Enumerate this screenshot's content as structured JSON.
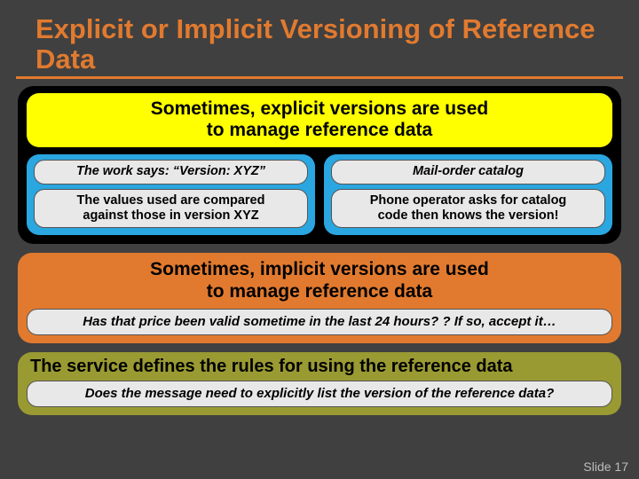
{
  "title": "Explicit or Implicit Versioning of Reference Data",
  "yellow": {
    "line1": "Sometimes, explicit versions are used",
    "line2": "to manage reference data"
  },
  "left": {
    "top": "The work says: “Version: XYZ”",
    "bottom_l1": "The values used are compared",
    "bottom_l2": "against those in version XYZ"
  },
  "right": {
    "top": "Mail-order catalog",
    "bottom_l1": "Phone operator asks for catalog",
    "bottom_l2": "code then knows the version!"
  },
  "orange": {
    "line1": "Sometimes, implicit versions are used",
    "line2": "to manage reference data",
    "pill": "Has that price been valid sometime in the last 24 hours? ?  If so, accept it…"
  },
  "olive": {
    "head": "The service defines the rules for using the reference data",
    "pill": "Does the message need to explicitly list the version of the reference data?"
  },
  "footer": "Slide 17"
}
